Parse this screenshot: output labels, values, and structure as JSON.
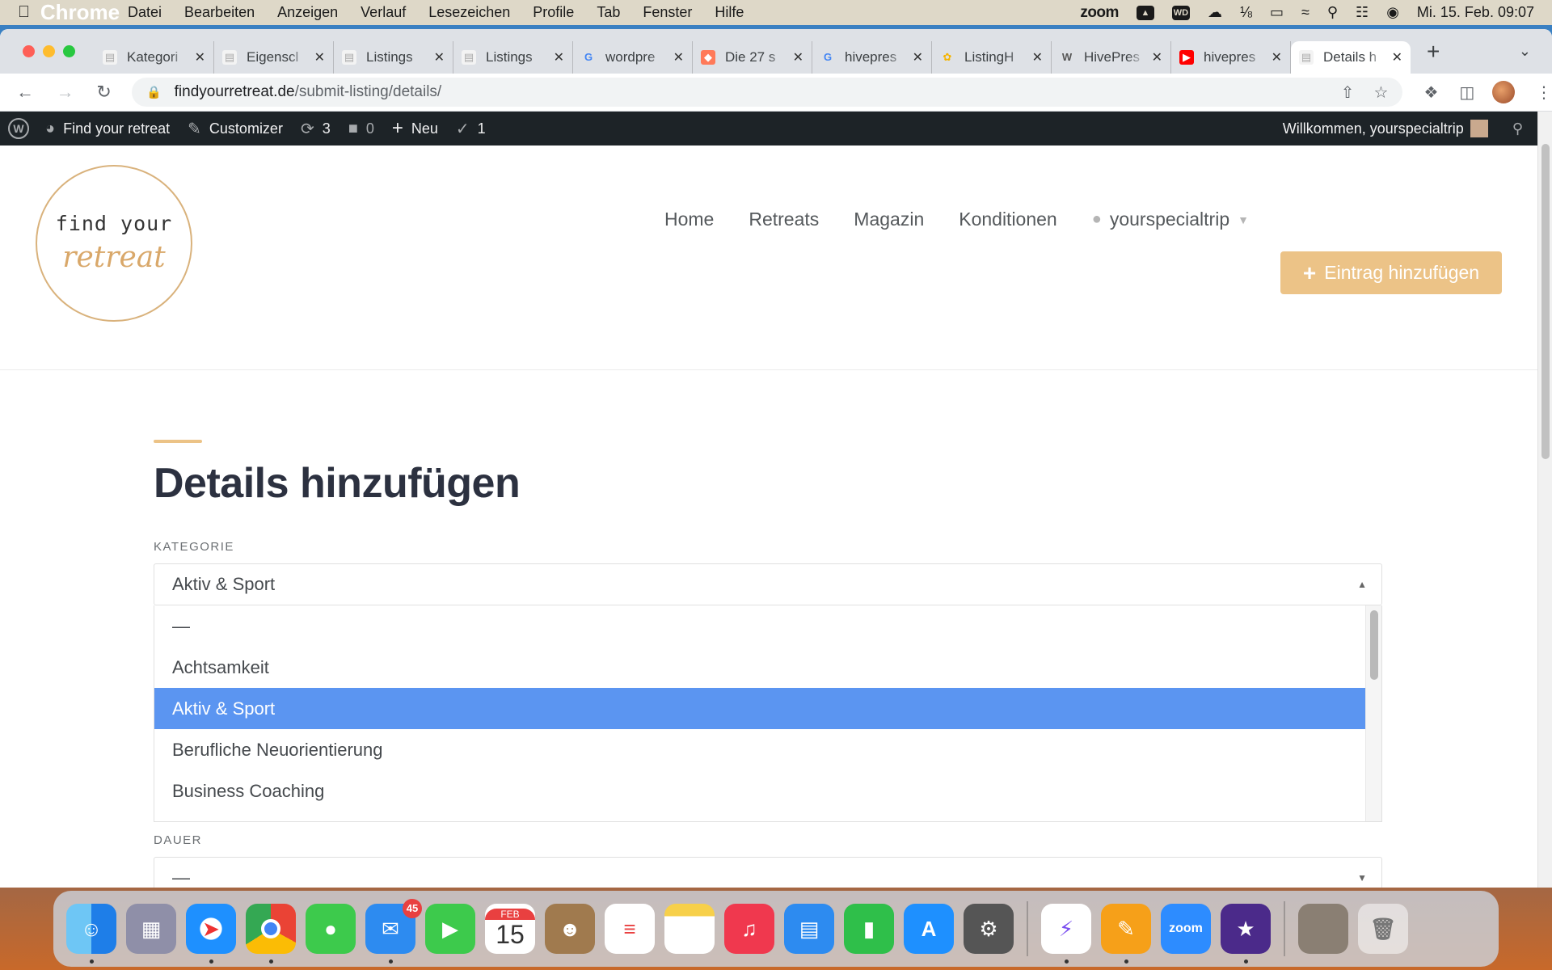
{
  "menubar": {
    "app_name": "Chrome",
    "menus": [
      "Datei",
      "Bearbeiten",
      "Anzeigen",
      "Verlauf",
      "Lesezeichen",
      "Profile",
      "Tab",
      "Fenster",
      "Hilfe"
    ],
    "zoom_label": "zoom",
    "wd_label": "WD",
    "datetime": "Mi. 15. Feb.  09:07"
  },
  "tabs": [
    {
      "title": "Kategori",
      "fav": "page",
      "active": false
    },
    {
      "title": "Eigenscl",
      "fav": "page",
      "active": false
    },
    {
      "title": "Listings",
      "fav": "page",
      "active": false
    },
    {
      "title": "Listings",
      "fav": "page",
      "active": false
    },
    {
      "title": "wordpre",
      "fav": "google",
      "active": false
    },
    {
      "title": "Die 27 s",
      "fav": "hubspot",
      "active": false
    },
    {
      "title": "hivepres",
      "fav": "google",
      "active": false
    },
    {
      "title": "ListingH",
      "fav": "listinghive",
      "active": false
    },
    {
      "title": "HivePres",
      "fav": "wordpress",
      "active": false
    },
    {
      "title": "hivepres",
      "fav": "youtube",
      "active": false
    },
    {
      "title": "Details h",
      "fav": "page",
      "active": true
    }
  ],
  "address": {
    "host": "findyourretreat.de",
    "path": "/submit-listing/details/"
  },
  "wpbar": {
    "site_name": "Find your retreat",
    "customizer": "Customizer",
    "updates": "3",
    "comments": "0",
    "new_label": "Neu",
    "yoast_count": "1",
    "welcome": "Willkommen, yourspecialtrip"
  },
  "logo": {
    "line1": "find your",
    "line2": "retreat"
  },
  "nav": {
    "items": [
      "Home",
      "Retreats",
      "Magazin",
      "Konditionen"
    ],
    "user": "yourspecialtrip",
    "add_button": "Eintrag hinzufügen"
  },
  "form": {
    "title": "Details hinzufügen",
    "category_label": "KATEGORIE",
    "category_value": "Aktiv & Sport",
    "options": [
      "—",
      "Achtsamkeit",
      "Aktiv & Sport",
      "Berufliche Neuorientierung",
      "Business Coaching"
    ],
    "selected_option": "Aktiv & Sport",
    "duration_label": "DAUER",
    "duration_value": "—"
  },
  "dock": {
    "mail_badge": "45",
    "calendar_month": "FEB",
    "calendar_day": "15",
    "zoom_label": "zoom"
  },
  "colors": {
    "accent": "#ecc387",
    "selected": "#5b95f1",
    "wpbar": "#1d2327"
  }
}
